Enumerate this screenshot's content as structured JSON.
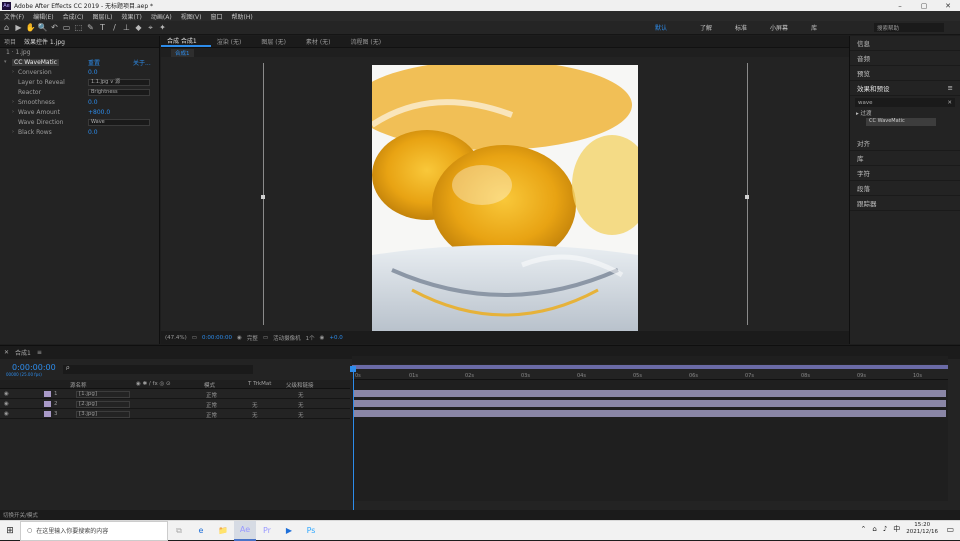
{
  "window": {
    "title": "Adobe After Effects CC 2019 - 无标题项目.aep *",
    "app_badge": "Ae",
    "min": "–",
    "max": "▢",
    "close": "✕"
  },
  "menu": [
    "文件(F)",
    "编辑(E)",
    "合成(C)",
    "图层(L)",
    "效果(T)",
    "动画(A)",
    "视图(V)",
    "窗口",
    "帮助(H)"
  ],
  "toolbar": {
    "tools": [
      "⌂",
      "▶",
      "✋",
      "🔍",
      "↶",
      "▭",
      "⬚",
      "✎",
      "T",
      "/",
      "⊥",
      "◆",
      "⌖",
      "✦"
    ],
    "workspaces": [
      "默认",
      "了解",
      "标准",
      "小屏幕",
      "库"
    ],
    "active_ws": "默认",
    "search_placeholder": "搜索帮助"
  },
  "effects_panel": {
    "tabs": [
      "项目",
      "效果控件 1.jpg"
    ],
    "layer": "1 · 1.jpg",
    "effect_name": "CC WaveMatic",
    "effect_reset": "重置",
    "effect_about": "关于...",
    "props": [
      {
        "label": "Conversion",
        "value": "0.0"
      },
      {
        "label": "Layer to Reveal",
        "value": "1.1.jpg ∨  源",
        "dropdown": true
      },
      {
        "label": "Reactor",
        "value": "Brightness",
        "dropdown": true
      },
      {
        "label": "Smoothness",
        "value": "0.0"
      },
      {
        "label": "Wave Amount",
        "value": "+800.0"
      },
      {
        "label": "Wave Direction",
        "value": "Wave",
        "dropdown": true
      },
      {
        "label": "Black Rows",
        "value": "0.0"
      }
    ]
  },
  "composition": {
    "tabs": [
      "合成 合成1",
      "渲染 (无)",
      "图层 (无)",
      "素材 (无)",
      "流程图 (无)"
    ],
    "sub_tab": "合成1",
    "bottom": [
      "(47.4%)",
      "▭",
      "0:00:00:00",
      "◉",
      "完整",
      "▭",
      "活动摄像机",
      "1个",
      "◉",
      "+0.0"
    ]
  },
  "right_panel": {
    "items_top": [
      "信息",
      "音频",
      "预览"
    ],
    "effects_header": "效果和预设",
    "search_value": "wave",
    "category": "▸ 过渡",
    "result": "CC WaveMatic",
    "items_bottom": [
      "对齐",
      "库",
      "字符",
      "段落",
      "跟踪器"
    ]
  },
  "timeline": {
    "tab": "合成1",
    "timecode": "0:00:00:00",
    "timecode_sub": "00000 (25.00 fps)",
    "search_placeholder": "ρ",
    "columns": [
      "源名称",
      "◉ ✱ ∕ fx ◎ ⊙",
      "模式",
      "T TrkMat",
      "父级和链接"
    ],
    "layers": [
      {
        "index": "1",
        "name": "[1.jpg]",
        "mode": "正常",
        "trk": "",
        "parent": "无"
      },
      {
        "index": "2",
        "name": "[2.jpg]",
        "mode": "正常",
        "trk": "无",
        "parent": "无"
      },
      {
        "index": "3",
        "name": "[3.jpg]",
        "mode": "正常",
        "trk": "无",
        "parent": "无"
      }
    ],
    "ruler": [
      "0s",
      "01s",
      "02s",
      "03s",
      "04s",
      "05s",
      "06s",
      "07s",
      "08s",
      "09s",
      "10s"
    ]
  },
  "status": {
    "text": "切换开关/模式"
  },
  "taskbar": {
    "search_placeholder": "在这里输入你要搜索的内容",
    "apps": [
      "⧉",
      "e",
      "📁",
      "Ae",
      "Pr",
      "▶",
      "Ps"
    ],
    "time": "15:20",
    "date": "2021/12/16"
  },
  "colors": {
    "accent": "#2d8ceb",
    "layer_label": "#a99ac8"
  }
}
